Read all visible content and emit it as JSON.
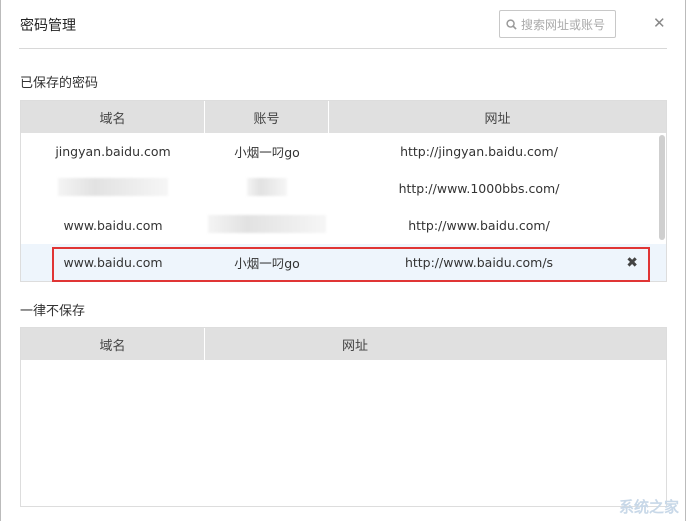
{
  "header": {
    "title": "密码管理",
    "search_placeholder": "搜索网址或账号",
    "close": "✕"
  },
  "saved": {
    "label": "已保存的密码",
    "columns": [
      "域名",
      "账号",
      "网址"
    ],
    "rows": [
      {
        "domain": "jingyan.baidu.com",
        "account": "小烟一叼go",
        "url": "http://jingyan.baidu.com/"
      },
      {
        "domain": "",
        "account": "",
        "url": "http://www.1000bbs.com/"
      },
      {
        "domain": "www.baidu.com",
        "account": "",
        "url": "http://www.baidu.com/"
      },
      {
        "domain": "www.baidu.com",
        "account": "小烟一叼go",
        "url": "http://www.baidu.com/s",
        "delete": "✖"
      }
    ]
  },
  "never": {
    "label": "一律不保存",
    "columns": [
      "域名",
      "网址"
    ]
  },
  "watermark": "系统之家"
}
